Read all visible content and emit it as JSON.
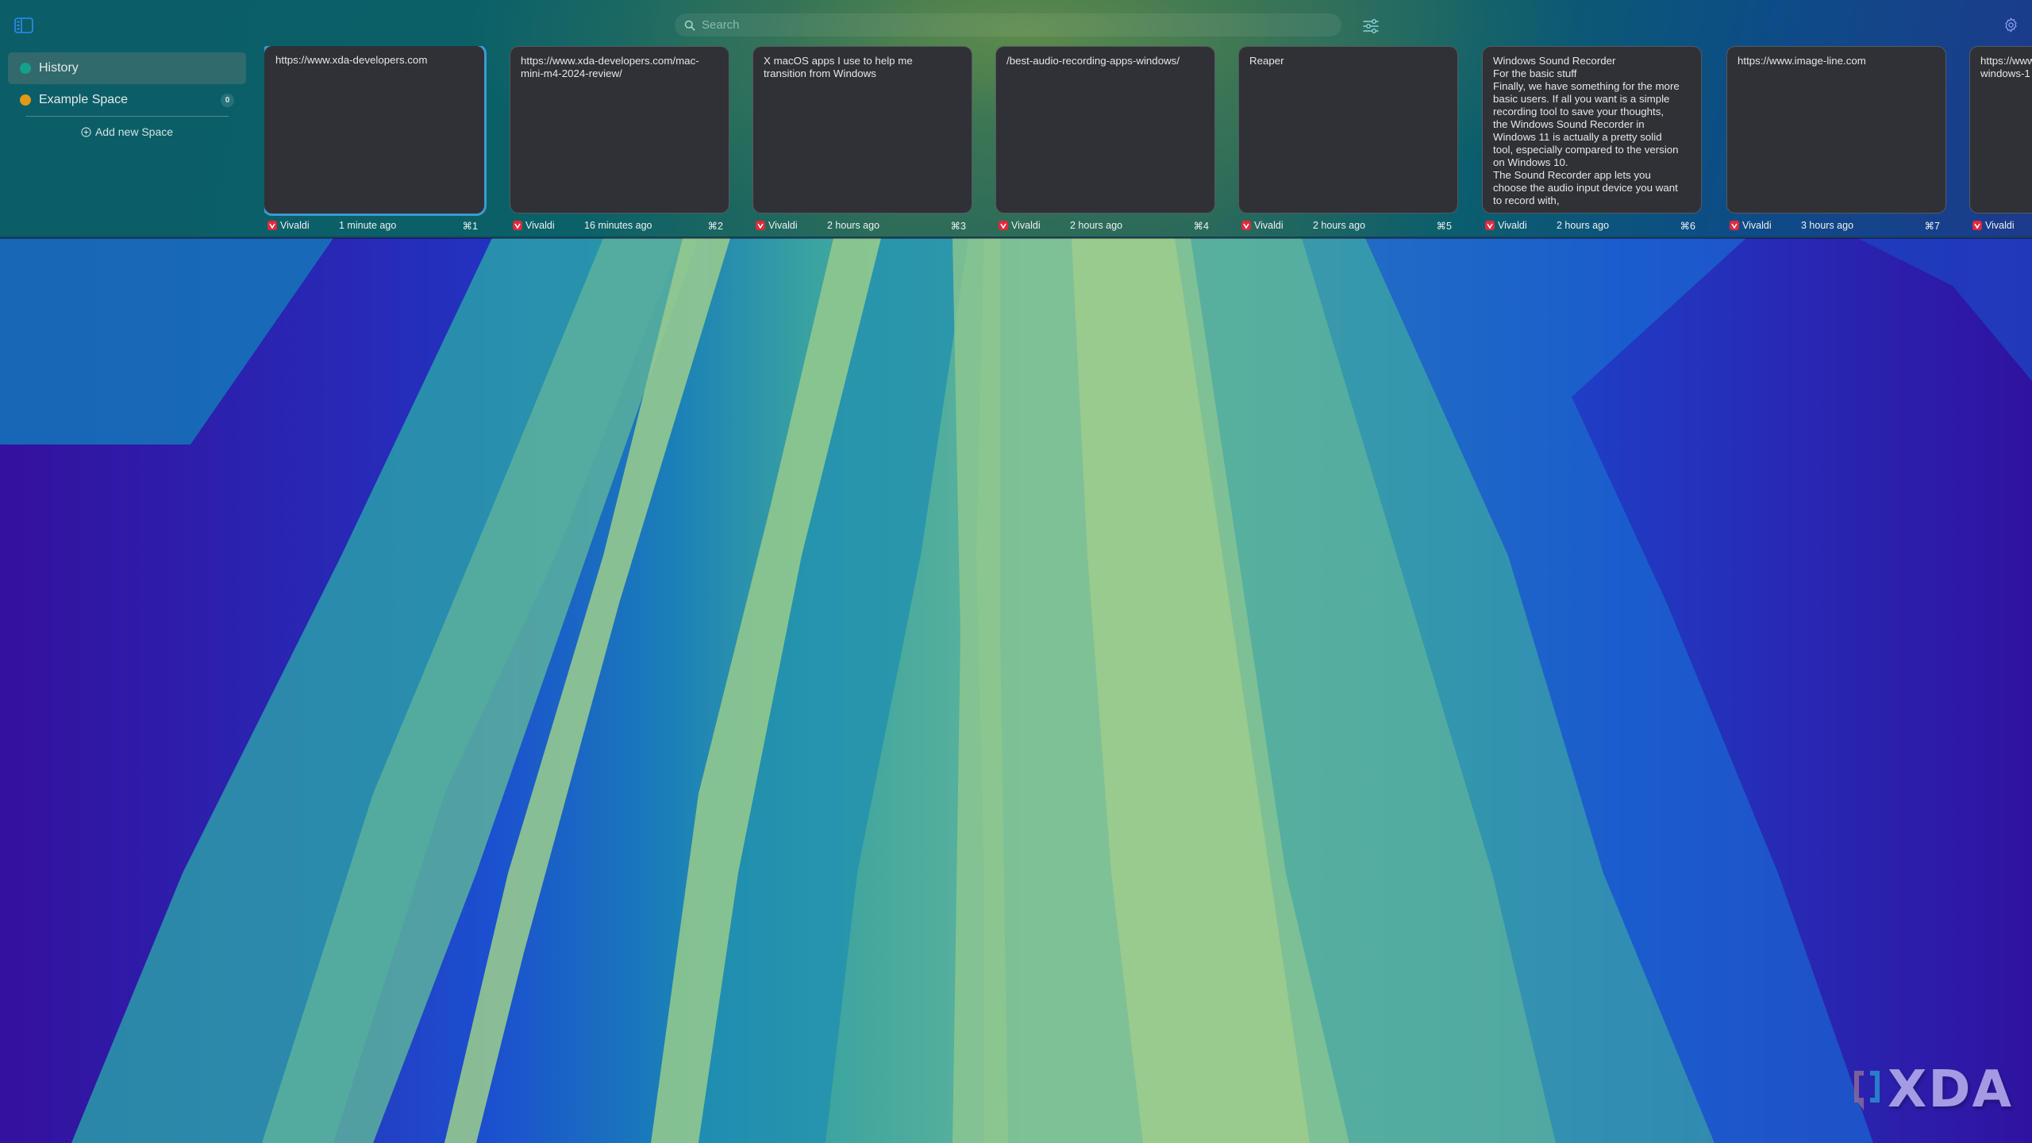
{
  "colors": {
    "accent_blue": "#3a9bd2",
    "card_bg": "#303136",
    "history_dot": "#14a08a",
    "example_space_dot": "#e09a14",
    "vivaldi_red": "#e0293a"
  },
  "toolbar": {
    "sidebar_toggle_icon": "sidebar-toggle-icon",
    "search": {
      "placeholder": "Search",
      "value": "",
      "icon": "search-icon"
    },
    "filter_icon": "sliders-icon",
    "settings_icon": "gear-icon"
  },
  "sidebar": {
    "spaces": [
      {
        "label": "History",
        "color": "#14a08a",
        "active": true,
        "badge": null
      },
      {
        "label": "Example Space",
        "color": "#e09a14",
        "active": false,
        "badge": "0"
      }
    ],
    "add_space_label": "Add new Space",
    "add_space_icon": "plus-circle-icon"
  },
  "cards": [
    {
      "text": "https://www.xda-developers.com",
      "app": "Vivaldi",
      "time": "1 minute ago",
      "shortcut": "⌘1",
      "selected": true
    },
    {
      "text": "https://www.xda-developers.com/mac-\nmini-m4-2024-review/",
      "app": "Vivaldi",
      "time": "16 minutes ago",
      "shortcut": "⌘2",
      "selected": false
    },
    {
      "text": "X macOS apps I use to help me\ntransition from Windows",
      "app": "Vivaldi",
      "time": "2 hours ago",
      "shortcut": "⌘3",
      "selected": false
    },
    {
      "text": "/best-audio-recording-apps-windows/",
      "app": "Vivaldi",
      "time": "2 hours ago",
      "shortcut": "⌘4",
      "selected": false
    },
    {
      "text": "Reaper",
      "app": "Vivaldi",
      "time": "2 hours ago",
      "shortcut": "⌘5",
      "selected": false
    },
    {
      "text": "Windows Sound Recorder\nFor the basic stuff\nFinally, we have something for the more\nbasic users. If all you want is a simple\nrecording tool to save your thoughts,\nthe Windows Sound Recorder in\nWindows 11 is actually a pretty solid\ntool, especially compared to the version\non Windows 10.\nThe Sound Recorder app lets you\nchoose the audio input device you want\nto record with,",
      "app": "Vivaldi",
      "time": "2 hours ago",
      "shortcut": "⌘6",
      "selected": false
    },
    {
      "text": "https://www.image-line.com",
      "app": "Vivaldi",
      "time": "3 hours ago",
      "shortcut": "⌘7",
      "selected": false
    },
    {
      "text": "https://www\nwindows-1",
      "app": "Vivaldi",
      "time": "",
      "shortcut": "",
      "selected": false
    }
  ],
  "watermark": {
    "text": "XDA"
  }
}
